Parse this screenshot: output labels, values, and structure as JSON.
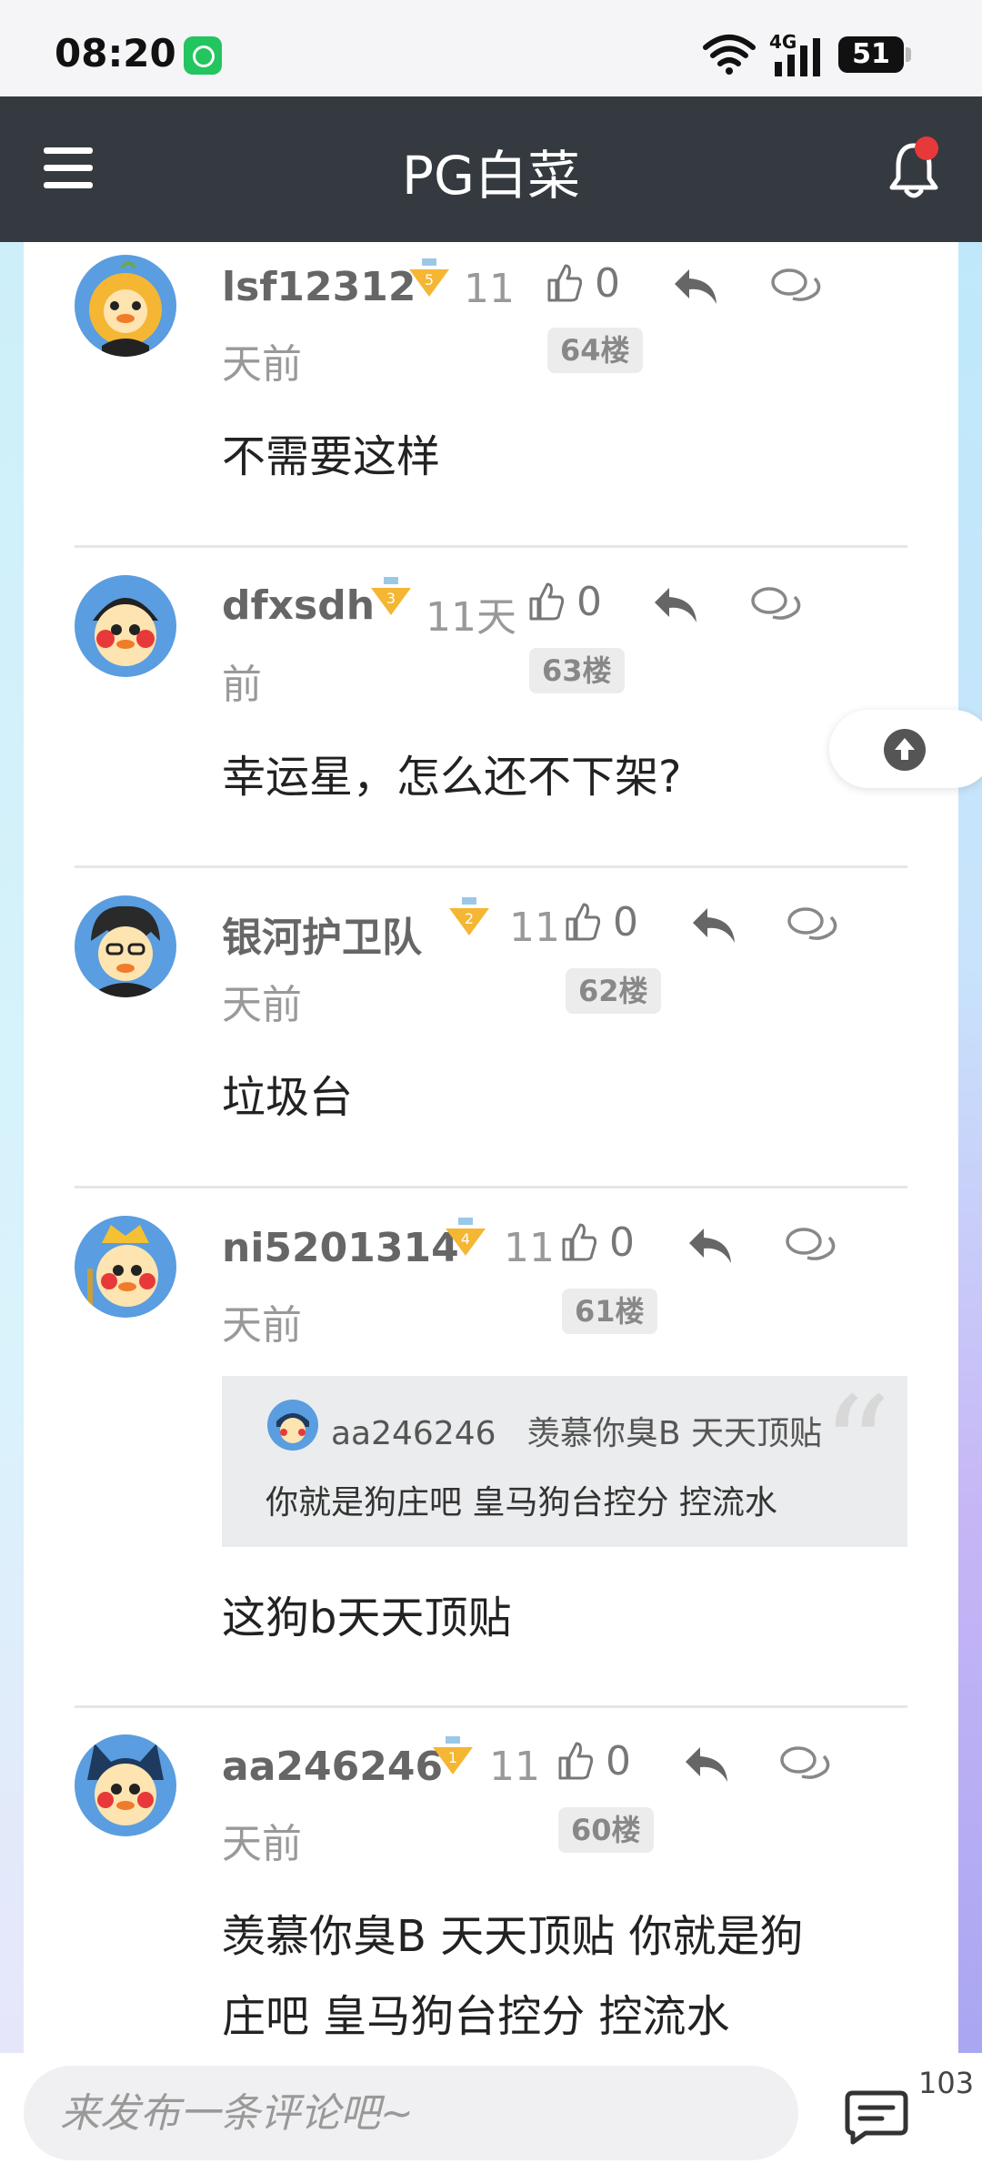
{
  "status_bar": {
    "time": "08:20",
    "network": "4G",
    "battery": "51"
  },
  "header": {
    "title": "PG白菜"
  },
  "comments": [
    {
      "username": "lsf12312",
      "level": "5",
      "days_a": "11",
      "days_b": "天前",
      "likes": "0",
      "floor": "64楼",
      "text": [
        "不需要这样"
      ]
    },
    {
      "username": "dfxsdh",
      "level": "3",
      "days_a": "11天",
      "days_b": "前",
      "likes": "0",
      "floor": "63楼",
      "text": [
        "幸运星，怎么还不下架?"
      ]
    },
    {
      "username": "银河护卫队",
      "level": "2",
      "days_a": "11",
      "days_b": "天前",
      "likes": "0",
      "floor": "62楼",
      "text": [
        "垃圾台"
      ]
    },
    {
      "username": "ni5201314",
      "level": "4",
      "days_a": "11",
      "days_b": "天前",
      "likes": "0",
      "floor": "61楼",
      "quote": {
        "username": "aa246246",
        "line1": "羡慕你臭B 天天顶贴",
        "line2": "你就是狗庄吧 皇马狗台控分 控流水"
      },
      "text": [
        "这狗b天天顶贴"
      ]
    },
    {
      "username": "aa246246",
      "level": "1",
      "days_a": "11",
      "days_b": "天前",
      "likes": "0",
      "floor": "60楼",
      "text": [
        "羡慕你臭B  天天顶贴  你就是狗",
        "庄吧  皇马狗台控分 控流水"
      ]
    }
  ],
  "bottom_bar": {
    "placeholder": "来发布一条评论吧~",
    "comment_count": "103"
  },
  "colors": {
    "header": "#353a40",
    "notification_dot": "#e8393a",
    "medal": "#f5b633"
  }
}
